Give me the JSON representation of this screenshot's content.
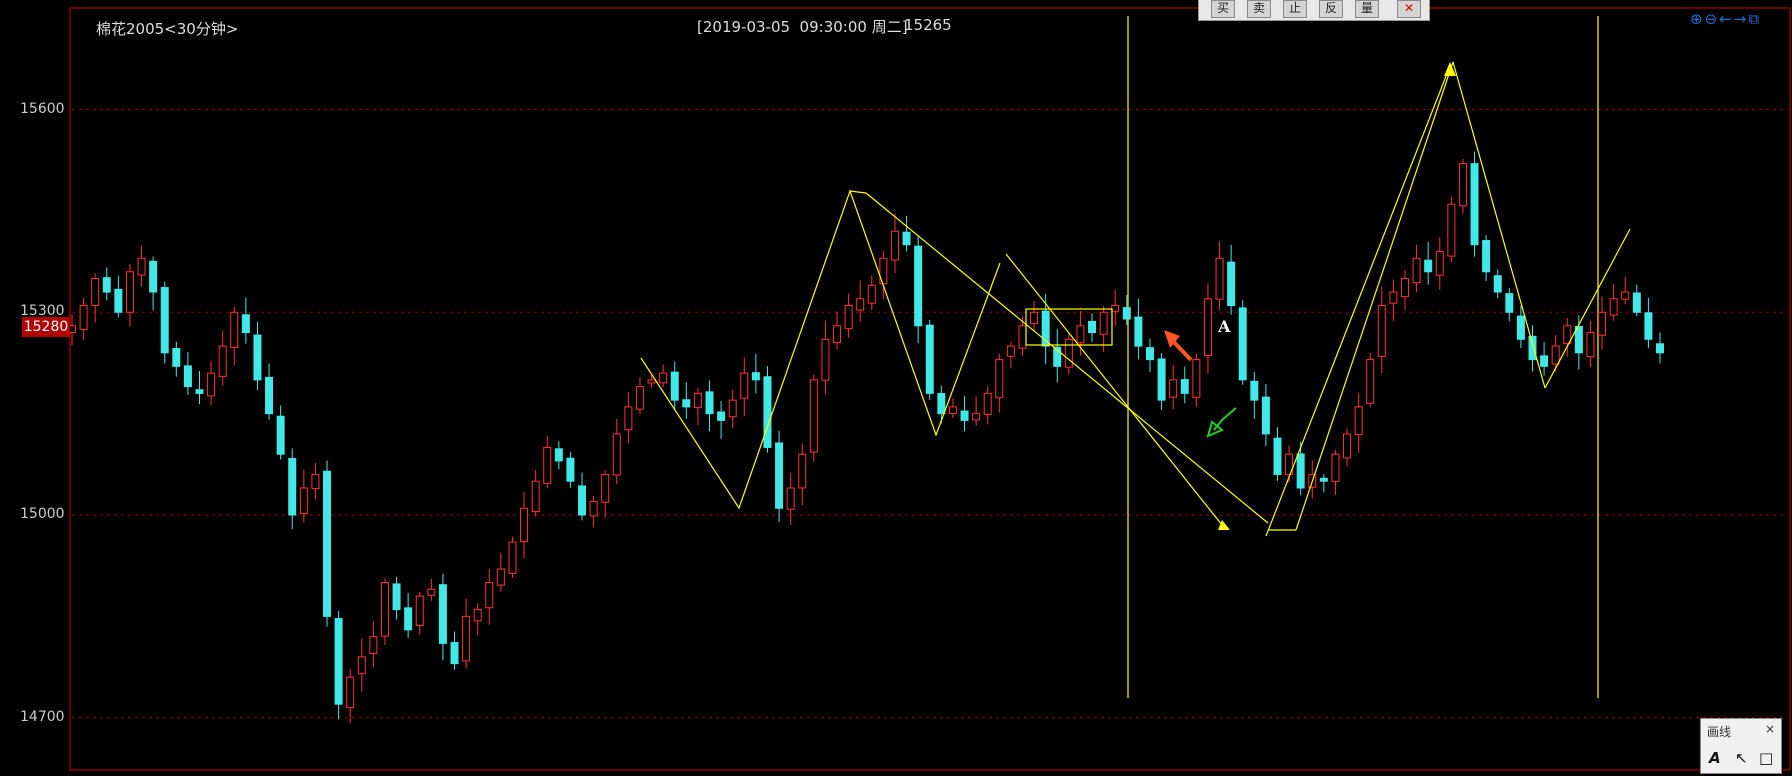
{
  "header": {
    "title": "棉花2005<30分钟>",
    "cursor_info": "[2019-03-05  09:30:00 周二]",
    "cursor_price": "15265"
  },
  "current_price_badge": "15280",
  "annotation_label": "A",
  "toolbar": {
    "buttons": [
      "买",
      "卖",
      "止",
      "反",
      "量"
    ],
    "close_icon": "close-x-icon"
  },
  "top_right_icons": [
    "zoom-in-icon",
    "zoom-out-icon",
    "arrow-left-icon",
    "arrow-right-icon",
    "detach-icon"
  ],
  "draw_panel": {
    "title": "画线",
    "close": "×",
    "tools": [
      "text-tool-icon",
      "pointer-tool-icon",
      "rectangle-tool-icon"
    ]
  },
  "colors": {
    "up": "#ff3030",
    "down": "#40e8e8",
    "drawing": "#ffff00",
    "marker_red": "#ff5522",
    "marker_green": "#20d020",
    "grid": "#8b0000"
  },
  "chart_data": {
    "type": "candlestick",
    "interval": "30分钟",
    "ylim": [
      14630,
      15740
    ],
    "yticks": [
      15600,
      15300,
      15000,
      14700
    ],
    "closes": [
      15280,
      15310,
      15350,
      15330,
      15300,
      15360,
      15380,
      15330,
      15240,
      15220,
      15190,
      15180,
      15210,
      15250,
      15300,
      15270,
      15200,
      15150,
      15090,
      15000,
      15040,
      15060,
      14850,
      14720,
      14760,
      14790,
      14820,
      14900,
      14860,
      14830,
      14880,
      14890,
      14810,
      14780,
      14850,
      14860,
      14900,
      14920,
      14960,
      15010,
      15050,
      15100,
      15080,
      15050,
      15000,
      15020,
      15060,
      15120,
      15160,
      15190,
      15200,
      15210,
      15170,
      15160,
      15180,
      15150,
      15140,
      15170,
      15210,
      15200,
      15100,
      15010,
      15040,
      15090,
      15200,
      15260,
      15280,
      15310,
      15320,
      15340,
      15380,
      15420,
      15400,
      15280,
      15180,
      15150,
      15160,
      15140,
      15150,
      15180,
      15230,
      15250,
      15280,
      15300,
      15250,
      15220,
      15260,
      15280,
      15270,
      15300,
      15310,
      15290,
      15250,
      15230,
      15170,
      15200,
      15180,
      15230,
      15320,
      15380,
      15310,
      15200,
      15170,
      15120,
      15060,
      15090,
      15040,
      15060,
      15050,
      15090,
      15120,
      15160,
      15230,
      15310,
      15330,
      15350,
      15380,
      15360,
      15390,
      15460,
      15520,
      15400,
      15360,
      15330,
      15300,
      15260,
      15230,
      15220,
      15250,
      15280,
      15240,
      15270,
      15300,
      15320,
      15330,
      15300,
      15260,
      15240
    ]
  }
}
